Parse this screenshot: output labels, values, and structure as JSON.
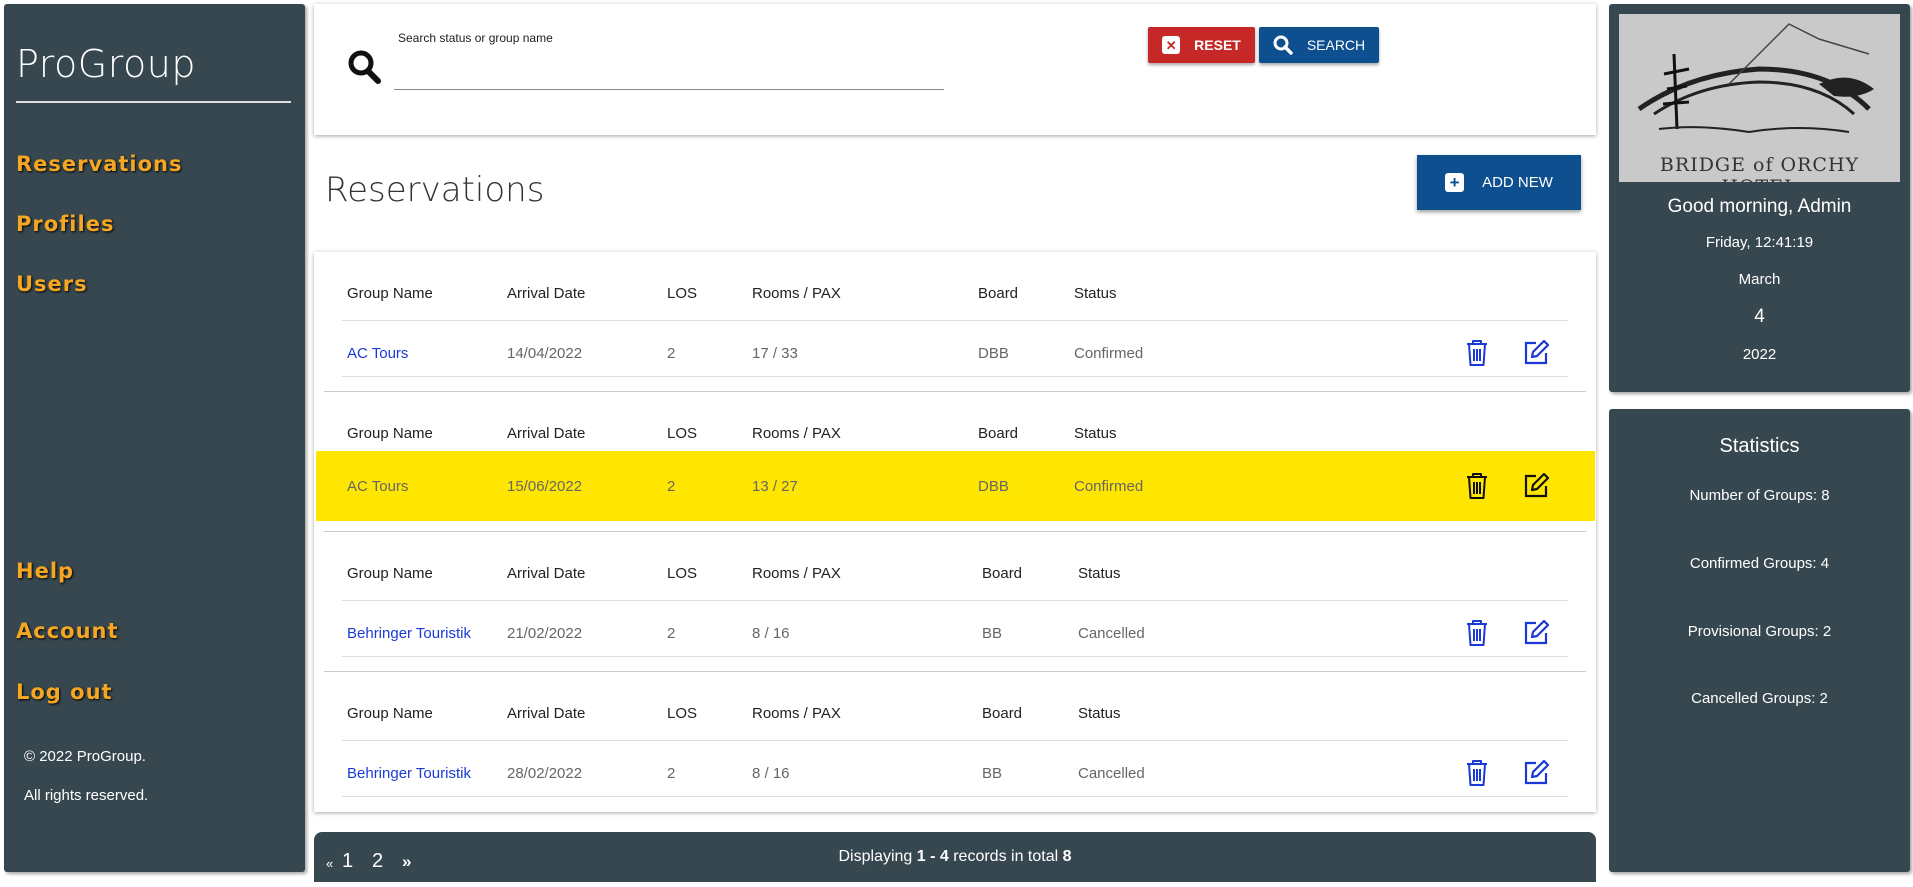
{
  "sidebar": {
    "brand": "ProGroup",
    "nav": [
      "Reservations",
      "Profiles",
      "Users"
    ],
    "bottom_nav": [
      "Help",
      "Account",
      "Log out"
    ],
    "copyright": "© 2022 ProGroup.",
    "rights": "All rights reserved.",
    "nav_color": "#f5a623",
    "bg_color": "#37474f"
  },
  "search": {
    "label": "Search status or group name",
    "value": "",
    "reset_label": "RESET",
    "search_label": "SEARCH",
    "icon": "search-icon"
  },
  "main": {
    "title": "Reservations",
    "add_new_label": "ADD NEW",
    "columns": [
      "Group Name",
      "Arrival Date",
      "LOS",
      "Rooms / PAX",
      "Board",
      "Status"
    ],
    "rows": [
      {
        "name": "AC Tours",
        "arrival": "14/04/2022",
        "los": "2",
        "rooms_pax": "17 / 33",
        "board": "DBB",
        "status": "Confirmed",
        "highlighted": false
      },
      {
        "name": "AC Tours",
        "arrival": "15/06/2022",
        "los": "2",
        "rooms_pax": "13 / 27",
        "board": "DBB",
        "status": "Confirmed",
        "highlighted": true
      },
      {
        "name": "Behringer Touristik",
        "arrival": "21/02/2022",
        "los": "2",
        "rooms_pax": "8 / 16",
        "board": "BB",
        "status": "Cancelled",
        "highlighted": false
      },
      {
        "name": "Behringer Touristik",
        "arrival": "28/02/2022",
        "los": "2",
        "rooms_pax": "8 / 16",
        "board": "BB",
        "status": "Cancelled",
        "highlighted": false
      }
    ],
    "highlight_color": "#ffe600",
    "link_color": "#1a3ad6"
  },
  "pager": {
    "prev": "«",
    "pages": [
      "1",
      "2"
    ],
    "next": "»",
    "info_prefix": "Displaying ",
    "info_range": "1 - 4",
    "info_middle": " records in total ",
    "info_total": "8"
  },
  "info_panel": {
    "logo_text": "BRIDGE of ORCHY HOTEL",
    "greeting": "Good morning, Admin",
    "time": "Friday, 12:41:19",
    "month": "March",
    "day": "4",
    "year": "2022"
  },
  "statistics": {
    "title": "Statistics",
    "items": [
      "Number of Groups: 8",
      "Confirmed Groups: 4",
      "Provisional Groups: 2",
      "Cancelled Groups: 2"
    ]
  }
}
